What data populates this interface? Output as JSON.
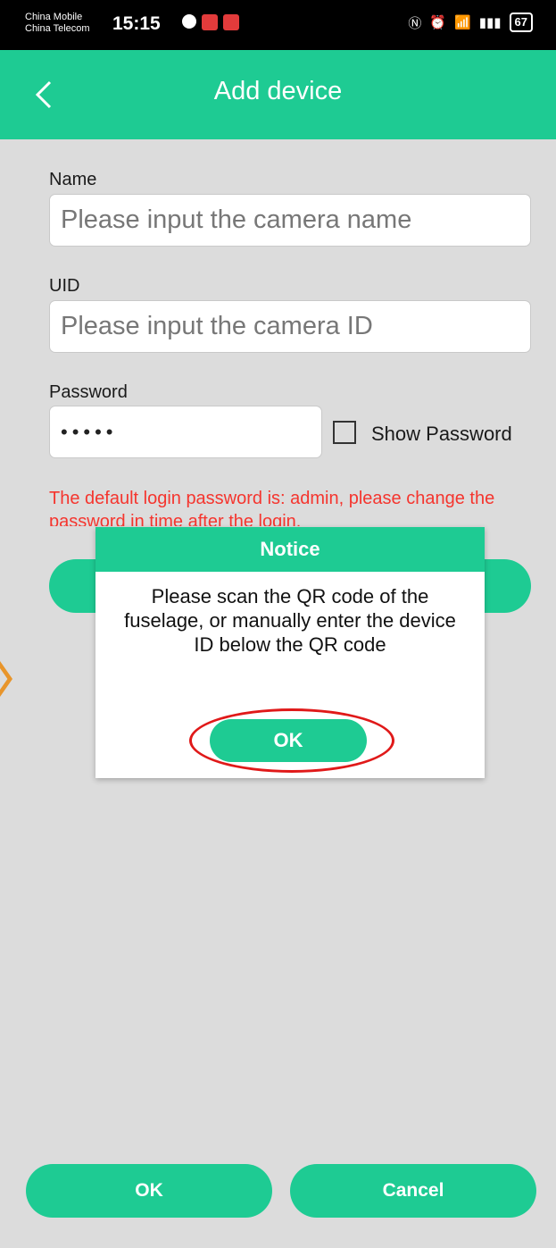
{
  "status_bar": {
    "carrier1": "China Mobile",
    "carrier2": "China Telecom",
    "time": "15:15",
    "battery": "67"
  },
  "header": {
    "title": "Add device"
  },
  "form": {
    "name_label": "Name",
    "name_placeholder": "Please input the camera name",
    "uid_label": "UID",
    "uid_placeholder": "Please input the camera ID",
    "password_label": "Password",
    "password_value": "•••••",
    "show_password_label": "Show Password",
    "warning": "The default login password is: admin, please change the password in time after the login."
  },
  "dialog": {
    "title": "Notice",
    "message": "Please scan the QR code of the fuselage, or manually enter the device ID below the QR code",
    "ok_label": "OK"
  },
  "footer": {
    "ok_label": "OK",
    "cancel_label": "Cancel"
  },
  "colors": {
    "accent": "#1ecb93",
    "warning": "#f5352e",
    "highlight": "#e01919"
  }
}
